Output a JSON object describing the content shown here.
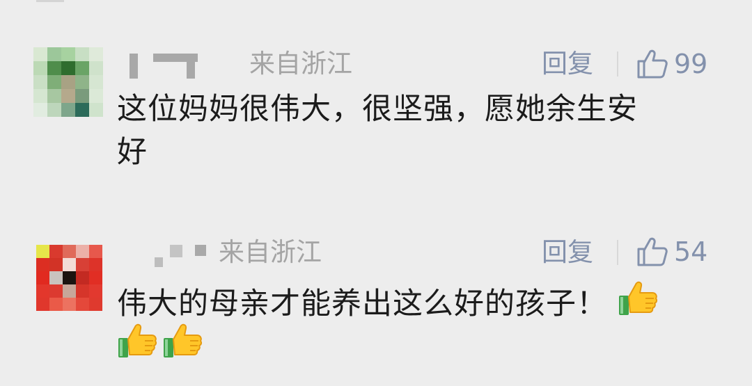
{
  "comments": [
    {
      "location": "来自浙江",
      "reply_label": "回复",
      "like_count": "99",
      "text_line1": "这位妈妈很伟大，很坚强，愿她余生安",
      "text_line2": "好",
      "icons": {
        "like": "thumbs-up-outline-icon"
      }
    },
    {
      "location": "来自浙江",
      "reply_label": "回复",
      "like_count": "54",
      "text": "伟大的母亲才能养出这么好的孩子！",
      "icons": {
        "like": "thumbs-up-outline-icon",
        "emoji": "thumbs-up-emoji-icon"
      }
    }
  ],
  "colors": {
    "background": "#ededed",
    "meta_text": "#a4a4a4",
    "action_text": "#8391ac",
    "body_text": "#1b1b1b"
  }
}
